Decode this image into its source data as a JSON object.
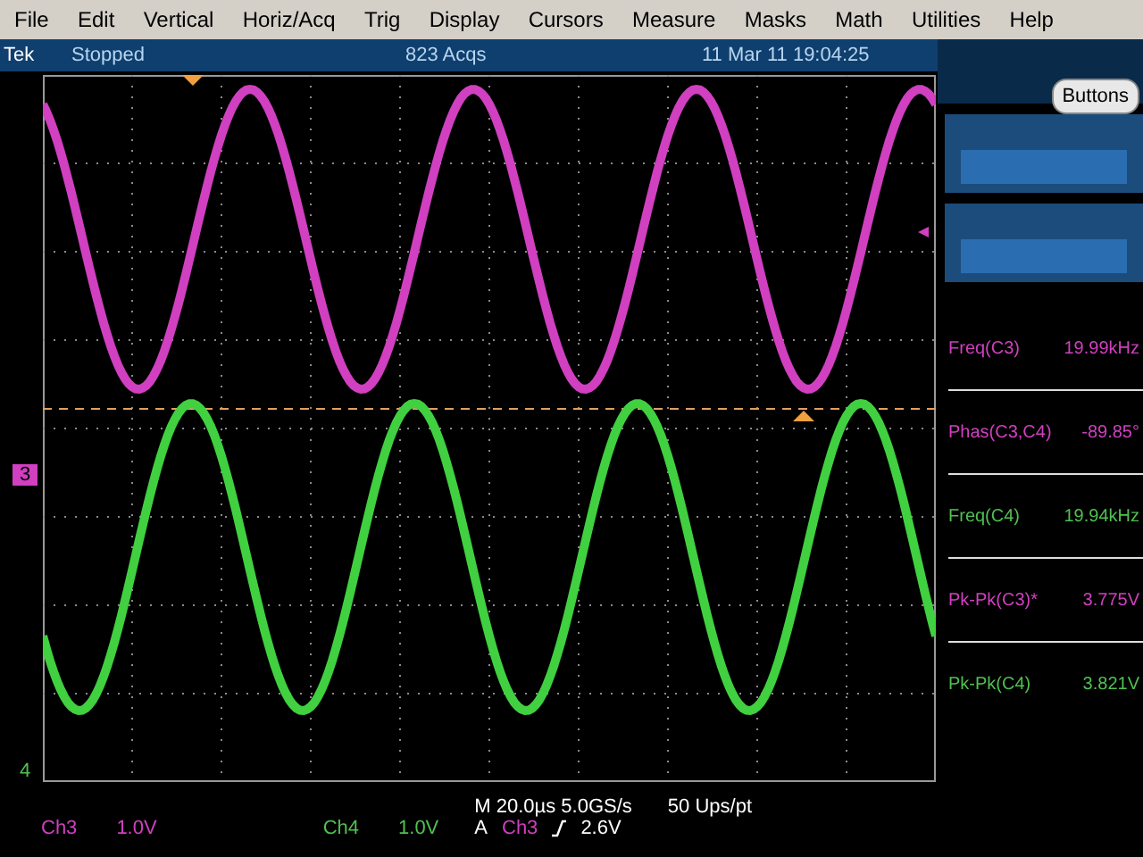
{
  "menu_bar": {
    "items": [
      {
        "label": "File"
      },
      {
        "label": "Edit"
      },
      {
        "label": "Vertical"
      },
      {
        "label": "Horiz/Acq"
      },
      {
        "label": "Trig"
      },
      {
        "label": "Display"
      },
      {
        "label": "Cursors"
      },
      {
        "label": "Measure"
      },
      {
        "label": "Masks"
      },
      {
        "label": "Math"
      },
      {
        "label": "Utilities"
      },
      {
        "label": "Help"
      }
    ]
  },
  "status_bar": {
    "brand": "Tek",
    "state": "Stopped",
    "acquisitions": "823 Acqs",
    "datetime": "11 Mar 11 19:04:25"
  },
  "side_panel": {
    "button": "Buttons",
    "measurements": [
      {
        "name": "Freq(C3)",
        "value": "19.99kHz",
        "color": "#d040c0"
      },
      {
        "name": "Phas(C3,C4)",
        "value": "-89.85°",
        "color": "#d040c0"
      },
      {
        "name": "Freq(C4)",
        "value": "19.94kHz",
        "color": "#50c050"
      },
      {
        "name": "Pk-Pk(C3)*",
        "value": "3.775V",
        "color": "#d040c0"
      },
      {
        "name": "Pk-Pk(C4)",
        "value": "3.821V",
        "color": "#50c050"
      }
    ]
  },
  "graticule": {
    "channel_markers": [
      {
        "label": "3",
        "color": "#d040c0"
      },
      {
        "label": "4",
        "color": "#50c050"
      }
    ]
  },
  "readouts": {
    "channels": [
      {
        "name": "Ch3",
        "scale": "1.0V",
        "color": "#d040c0"
      },
      {
        "name": "Ch4",
        "scale": "1.0V",
        "color": "#50c050"
      }
    ],
    "timebase": "M 20.0µs 5.0GS/s",
    "resolution": "50 Ups/pt",
    "trigger": {
      "mode": "A",
      "source": "Ch3",
      "level": "2.6V"
    }
  }
}
